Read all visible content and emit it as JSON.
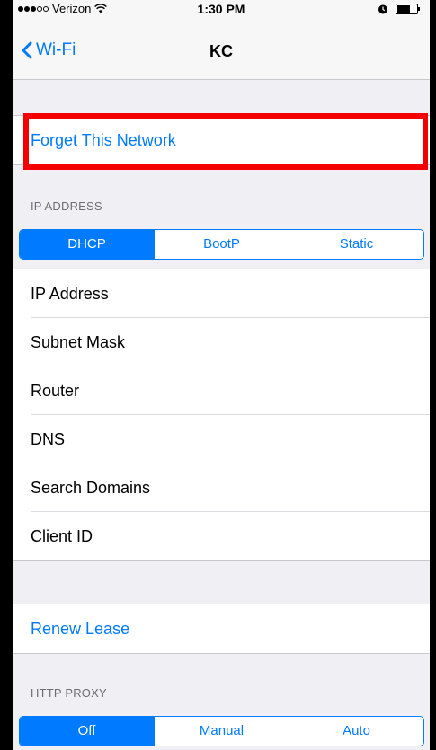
{
  "status_bar": {
    "carrier": "Verizon",
    "time": "1:30 PM"
  },
  "nav": {
    "back_label": "Wi-Fi",
    "title": "KC"
  },
  "forget": {
    "label": "Forget This Network"
  },
  "ip_section": {
    "header": "IP ADDRESS",
    "segments": [
      "DHCP",
      "BootP",
      "Static"
    ],
    "selected": "DHCP",
    "rows": [
      "IP Address",
      "Subnet Mask",
      "Router",
      "DNS",
      "Search Domains",
      "Client ID"
    ]
  },
  "renew": {
    "label": "Renew Lease"
  },
  "proxy_section": {
    "header": "HTTP PROXY",
    "segments": [
      "Off",
      "Manual",
      "Auto"
    ],
    "selected": "Off"
  },
  "colors": {
    "accent": "#007aff",
    "highlight": "#f40000",
    "background": "#efeff4"
  }
}
